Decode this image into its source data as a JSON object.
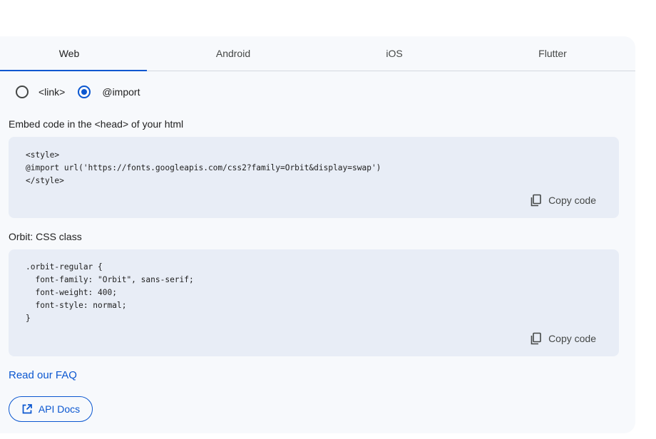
{
  "tabs": [
    {
      "label": "Web"
    },
    {
      "label": "Android"
    },
    {
      "label": "iOS"
    },
    {
      "label": "Flutter"
    }
  ],
  "active_tab": "Web",
  "embed_options": [
    {
      "label": "<link>",
      "selected": false
    },
    {
      "label": "@import",
      "selected": true
    }
  ],
  "embed_section": {
    "label": "Embed code in the <head> of your html",
    "code": "<style>\n@import url('https://fonts.googleapis.com/css2?family=Orbit&display=swap')\n</style>",
    "copy_label": "Copy code",
    "copy_icon": "copy-icon"
  },
  "css_section": {
    "label": "Orbit: CSS class",
    "code": ".orbit-regular {\n  font-family: \"Orbit\", sans-serif;\n  font-weight: 400;\n  font-style: normal;\n}",
    "copy_label": "Copy code",
    "copy_icon": "copy-icon"
  },
  "faq_link": "Read our FAQ",
  "api_docs": {
    "label": "API Docs",
    "icon": "open-in-new-icon"
  },
  "colors": {
    "accent": "#0b57d0",
    "panel_bg": "#f7f9fc",
    "code_bg": "#e8edf6"
  }
}
